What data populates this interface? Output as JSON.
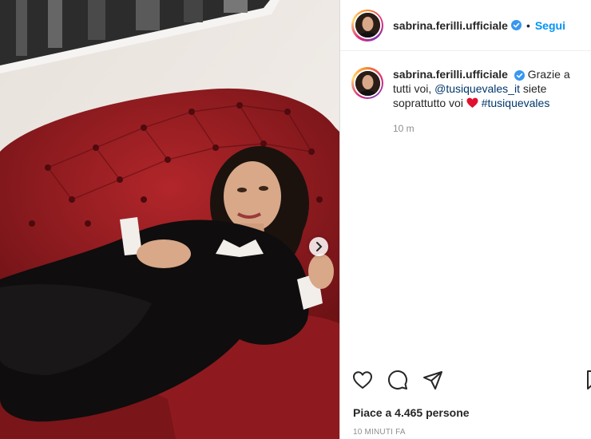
{
  "post": {
    "username": "sabrina.ferilli.ufficiale",
    "follow_label": "Segui",
    "separator": "•"
  },
  "caption": {
    "username": "sabrina.ferilli.ufficiale",
    "text_before": "Grazie a tutti voi,",
    "mention": "@tusiquevales_it",
    "text_middle": "siete soprattutto voi",
    "hashtag": "#tusiquevales",
    "time": "10 m"
  },
  "likes_label": "Piace a 4.465 persone",
  "posted_time": "10 MINUTI FA",
  "icons": {
    "verified": "verified-badge-icon",
    "heart": "heart-icon",
    "comment": "comment-icon",
    "share": "share-icon",
    "bookmark": "bookmark-icon",
    "next": "chevron-right-icon",
    "emoji": "red-heart-emoji"
  },
  "colors": {
    "accent": "#0095f6",
    "link": "#00376b",
    "muted": "#8e8e8e",
    "verified": "#3897f0",
    "emoji_heart": "#e0102e"
  },
  "carousel": {
    "slides": 2,
    "current": 1
  }
}
